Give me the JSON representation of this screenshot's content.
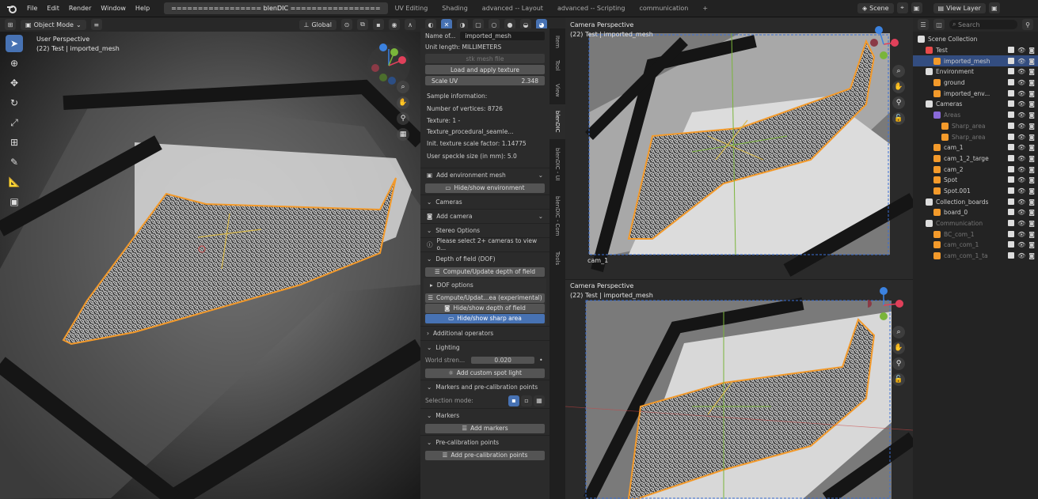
{
  "menu": [
    "File",
    "Edit",
    "Render",
    "Window",
    "Help"
  ],
  "workspaces": {
    "active": "================= blenDIC =================",
    "others": [
      "UV Editing",
      "Shading",
      "advanced -- Layout",
      "advanced -- Scripting",
      "communication"
    ],
    "add": "+"
  },
  "scene": {
    "icon": "scene-icon",
    "name": "Scene",
    "view_layer": "View Layer"
  },
  "viewport_header": {
    "mode": "Object Mode",
    "orientation": "Global"
  },
  "left_viewport": {
    "title": "User Perspective",
    "subtitle": "(22) Test | imported_mesh"
  },
  "cam_views": [
    {
      "title": "Camera Perspective",
      "subtitle": "(22) Test | imported_mesh",
      "cam_name": "cam_1"
    },
    {
      "title": "Camera Perspective",
      "subtitle": "(22) Test | imported_mesh"
    }
  ],
  "npanel": {
    "name_label": "Name of...",
    "name_value": "imported_mesh",
    "unit": "Unit length: MILLIMETERS",
    "stl_btn": "stk mesh file",
    "load_btn": "Load and apply texture",
    "scale_label": "Scale UV",
    "scale_value": "2.348",
    "info_title": "Sample information:",
    "info": [
      "Number of vertices: 8726",
      "Texture: 1 - Texture_procedural_seamle...",
      "Init. texture scale factor: 1.14775",
      "User speckle size (in mm): 5.0"
    ],
    "add_env": "Add environment mesh",
    "hide_env": "Hide/show environment",
    "cameras": "Cameras",
    "add_camera": "Add camera",
    "stereo": "Stereo Options",
    "stereo_note": "Please select 2+ cameras to view o...",
    "dof": "Depth of field (DOF)",
    "compute_dof": "Compute/Update depth of field",
    "dof_opts": "DOF options",
    "compute_exp": "Compute/Updat...ea (experimental)",
    "hide_dof": "Hide/show depth of field",
    "hide_sharp": "Hide/show sharp area",
    "additional": "Additional operators",
    "lighting": "Lighting",
    "world_label": "World stren...",
    "world_value": "0.020",
    "spot": "Add custom spot light",
    "markers_pre": "Markers and pre-calibration points",
    "selmode": "Selection mode:",
    "markers": "Markers",
    "add_markers": "Add markers",
    "pre_cal": "Pre-calibration points",
    "add_pre": "Add pre-calibration points"
  },
  "tabs": [
    "Item",
    "Tool",
    "View",
    "blenDIC",
    "blenDIC - UI",
    "blenDIC - Com",
    "Tools"
  ],
  "outliner": {
    "search_placeholder": "Search",
    "rows": [
      {
        "label": "Scene Collection",
        "level": 0
      },
      {
        "label": "Test",
        "level": 1
      },
      {
        "label": "imported_mesh",
        "level": 2
      },
      {
        "label": "Environment",
        "level": 1
      },
      {
        "label": "ground",
        "level": 2
      },
      {
        "label": "imported_env...",
        "level": 2
      },
      {
        "label": "Cameras",
        "level": 1
      },
      {
        "label": "Areas",
        "level": 2
      },
      {
        "label": "Sharp_area",
        "level": 3
      },
      {
        "label": "Sharp_area",
        "level": 3
      },
      {
        "label": "cam_1",
        "level": 2
      },
      {
        "label": "cam_1_2_targe",
        "level": 2
      },
      {
        "label": "cam_2",
        "level": 2
      },
      {
        "label": "Spot",
        "level": 2
      },
      {
        "label": "Spot.001",
        "level": 2
      },
      {
        "label": "Collection_boards",
        "level": 1
      },
      {
        "label": "board_0",
        "level": 2
      },
      {
        "label": "Communication",
        "level": 1
      },
      {
        "label": "BC_com_1",
        "level": 2
      },
      {
        "label": "cam_com_1",
        "level": 2
      },
      {
        "label": "cam_com_1_ta",
        "level": 2
      }
    ]
  },
  "colors": {
    "accent": "#4772b3",
    "mesh_outline": "#f39a2b",
    "axis_x": "#e0405a",
    "axis_y": "#7ab53a",
    "axis_z": "#3b82e0"
  }
}
